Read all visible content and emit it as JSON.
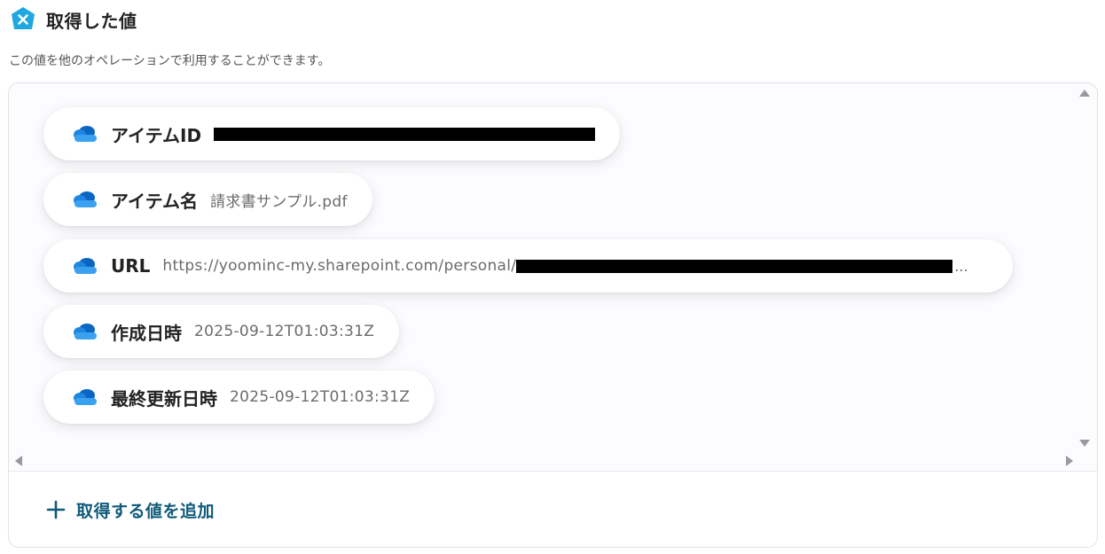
{
  "header": {
    "title": "取得した値",
    "subtitle": "この値を他のオペレーションで利用することができます。",
    "logo_color": "#1fa8e0"
  },
  "items": [
    {
      "label": "アイテムID",
      "value": "",
      "redacted": true
    },
    {
      "label": "アイテム名",
      "value": "請求書サンプル.pdf"
    },
    {
      "label": "URL",
      "value": "https://yoominc-my.sharepoint.com/personal/",
      "ellipsis": "..."
    },
    {
      "label": "作成日時",
      "value": "2025-09-12T01:03:31Z"
    },
    {
      "label": "最終更新日時",
      "value": "2025-09-12T01:03:31Z"
    }
  ],
  "add_button": {
    "label": "取得する値を追加"
  },
  "colors": {
    "accent": "#0f5a7a",
    "cloud_light": "#3aa0f0",
    "cloud_dark": "#0a66c2"
  }
}
